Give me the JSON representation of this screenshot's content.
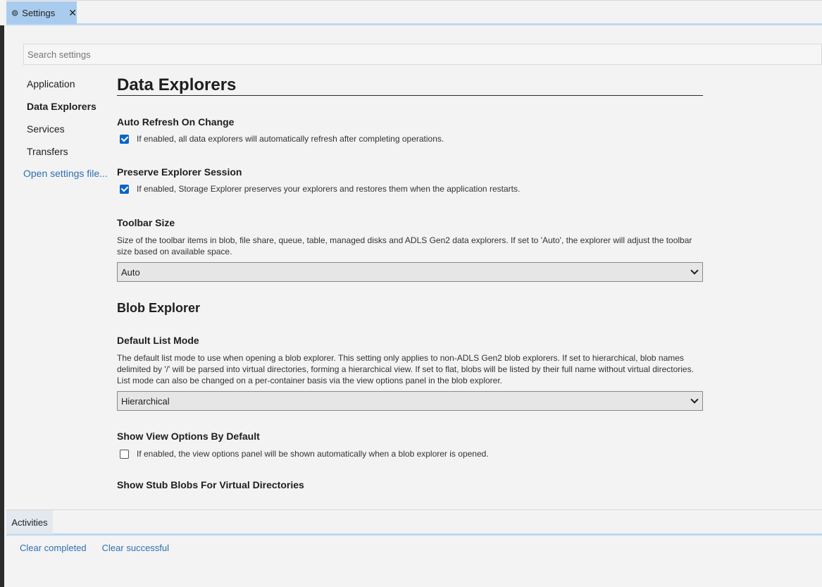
{
  "tabs": [
    {
      "label": "Settings"
    }
  ],
  "search": {
    "placeholder": "Search settings"
  },
  "nav": {
    "items": [
      {
        "label": "Application"
      },
      {
        "label": "Data Explorers",
        "active": true
      },
      {
        "label": "Services"
      },
      {
        "label": "Transfers"
      }
    ],
    "open_file_link": "Open settings file..."
  },
  "content": {
    "title": "Data Explorers",
    "auto_refresh": {
      "title": "Auto Refresh On Change",
      "checked": true,
      "description": "If enabled, all data explorers will automatically refresh after completing operations."
    },
    "preserve_session": {
      "title": "Preserve Explorer Session",
      "checked": true,
      "description": "If enabled, Storage Explorer preserves your explorers and restores them when the application restarts."
    },
    "toolbar_size": {
      "title": "Toolbar Size",
      "description": "Size of the toolbar items in blob, file share, queue, table, managed disks and ADLS Gen2 data explorers. If set to 'Auto', the explorer will adjust the toolbar size based on available space.",
      "value": "Auto"
    },
    "blob_section_title": "Blob Explorer",
    "default_list_mode": {
      "title": "Default List Mode",
      "description": "The default list mode to use when opening a blob explorer. This setting only applies to non-ADLS Gen2 blob explorers. If set to hierarchical, blob names delimited by '/' will be parsed into virtual directories, forming a hierarchical view. If set to flat, blobs will be listed by their full name without virtual directories. List mode can also be changed on a per-container basis via the view options panel in the blob explorer.",
      "value": "Hierarchical"
    },
    "show_view_options": {
      "title": "Show View Options By Default",
      "checked": false,
      "description": "If enabled, the view options panel will be shown automatically when a blob explorer is opened."
    },
    "cut_off_title": "Show Stub Blobs For Virtual Directories"
  },
  "bottom_panel": {
    "tab_label": "Activities",
    "clear_completed": "Clear completed",
    "clear_successful": "Clear successful"
  },
  "colors": {
    "tab_active": "#a9ccee",
    "link": "#2e6fb3",
    "checkbox": "#0a66c2"
  }
}
